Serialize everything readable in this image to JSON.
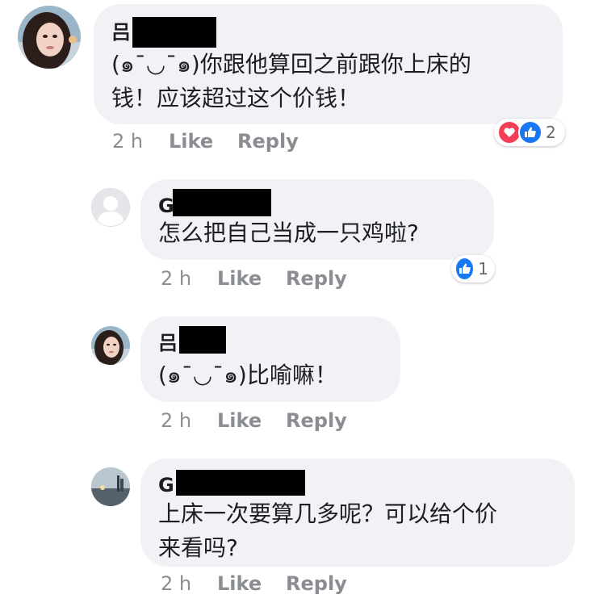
{
  "comments": [
    {
      "author": "吕",
      "text": "(๑¯◡¯๑)你跟他算回之前跟你上床的\n钱！应该超过这个价钱！",
      "time": "2 h",
      "like": "Like",
      "reply": "Reply",
      "reaction_count": "2",
      "reactions": [
        "heart-icon",
        "thumbs-up-icon"
      ]
    },
    {
      "author": "G",
      "text": "怎么把自己当成一只鸡啦?",
      "time": "2 h",
      "like": "Like",
      "reply": "Reply",
      "reaction_count": "1",
      "reactions": [
        "thumbs-up-icon"
      ]
    },
    {
      "author": "吕",
      "text": "(๑¯◡¯๑)比喻嘛！",
      "time": "2 h",
      "like": "Like",
      "reply": "Reply"
    },
    {
      "author": "G",
      "text": "上床一次要算几多呢？可以给个价\n来看吗?",
      "time": "2 h",
      "like": "Like",
      "reply": "Reply"
    }
  ],
  "colors": {
    "bubble": "#f0f2f5",
    "meta_text": "#8a8d91",
    "like_blue": "#1877f2",
    "love_red": "#f33e58",
    "redaction": "#000000"
  }
}
